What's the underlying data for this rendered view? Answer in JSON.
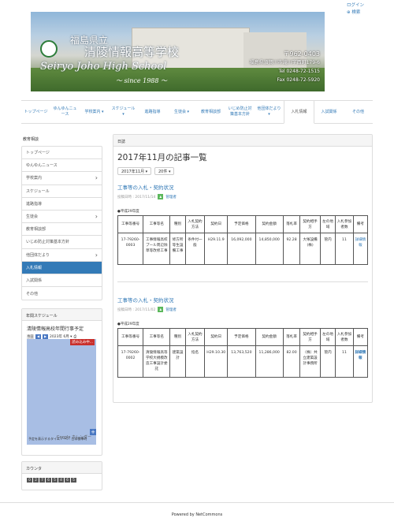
{
  "header": {
    "login": "ログイン",
    "search": "検索"
  },
  "banner": {
    "school_ja_1": "福島県立",
    "school_ja_2": "清陵情報高等学校",
    "school_en": "Seiryo Joho High School",
    "since": "～ since 1988 ～",
    "zip": "〒962-0403",
    "address": "福島県須賀川市滝川字西町179-6",
    "tel": "Tel 0248-72-1515",
    "fax": "Fax 0248-72-5920"
  },
  "nav": {
    "items": [
      {
        "label": "トップページ",
        "active": false
      },
      {
        "label": "ゆんゆんニュース",
        "active": false
      },
      {
        "label": "学校案内 ▾",
        "active": false
      },
      {
        "label": "スケジュール ▾",
        "active": false
      },
      {
        "label": "進路指導",
        "active": false
      },
      {
        "label": "生徒会 ▾",
        "active": false
      },
      {
        "label": "教育相談部",
        "active": false
      },
      {
        "label": "いじめ防止対策基本方針",
        "active": false
      },
      {
        "label": "他団体だより ▾",
        "active": false
      },
      {
        "label": "入札情報",
        "active": true
      },
      {
        "label": "入試関係",
        "active": false
      },
      {
        "label": "その他",
        "active": false
      }
    ]
  },
  "sidebar": {
    "heading": "教育相談",
    "items": [
      {
        "label": "トップページ",
        "chev": ""
      },
      {
        "label": "ゆんゆんニュース",
        "chev": ""
      },
      {
        "label": "学校案内",
        "chev": "›"
      },
      {
        "label": "スケジュール",
        "chev": ""
      },
      {
        "label": "進路指導",
        "chev": ""
      },
      {
        "label": "生徒会",
        "chev": "›"
      },
      {
        "label": "教育相談部",
        "chev": ""
      },
      {
        "label": "いじめ防止対策基本方針",
        "chev": ""
      },
      {
        "label": "他団体だより",
        "chev": "›"
      },
      {
        "label": "入札情報",
        "chev": ""
      },
      {
        "label": "入試関係",
        "chev": ""
      },
      {
        "label": "その他",
        "chev": ""
      }
    ]
  },
  "calendar": {
    "heading": "年間スケジュール",
    "title": "清陵情報高校年間行事予定",
    "today": "今日",
    "month": "2023年 6月 ▾",
    "loading": "読み込み中...",
    "timezone_note": "予定を表示するタイムゾーン: 日本標準時",
    "brand": "Google カレンダー"
  },
  "counter": {
    "heading": "カウンタ",
    "digits": [
      "0",
      "2",
      "7",
      "6",
      "5",
      "4",
      "6",
      "5"
    ]
  },
  "main": {
    "panel_heading": "日誌",
    "page_title": "2017年11月の記事一覧",
    "month_select": "2017年11月 ▾",
    "count_select": "20件 ▾",
    "columns": [
      "工事等番号",
      "工事等名",
      "種別",
      "入札契約方法",
      "契約日",
      "予定価格",
      "契約金額",
      "落札率",
      "契約相手方",
      "左の地域",
      "入札参加者数",
      "備考"
    ],
    "articles": [
      {
        "title": "工事等の入札・契約状況",
        "posted": "投稿日時 : 2017/11/14",
        "author": "管理者",
        "year": "●平成29年度",
        "row": [
          "17-79260-0003",
          "工事情報高校プール周辺除草等改修工事",
          "修方所等生設備工事",
          "条件付一般",
          "H29.11.9",
          "16,092,000",
          "14,850,000",
          "92.28",
          "大塚設備(株)",
          "管内",
          "11",
          "詳細情報"
        ]
      },
      {
        "title": "工事等の入札・契約状況",
        "posted": "投稿日時 : 2017/11/02",
        "author": "管理者",
        "year": "●平成29年度",
        "row": [
          "17-79260-0002",
          "清陵情報高等学校大規模改造工事設計委託",
          "建築設計",
          "指名",
          "H29.10.30",
          "13,763,520",
          "11,286,000",
          "82.00",
          "（株）共立建築設計事務所",
          "管内",
          "11",
          "詳細情報"
        ]
      }
    ]
  },
  "footer": "Powered by NetCommons"
}
